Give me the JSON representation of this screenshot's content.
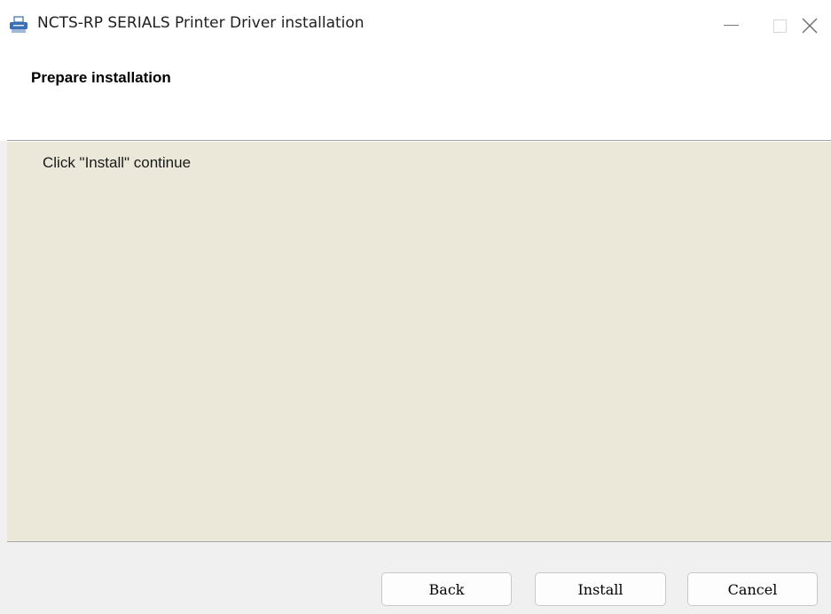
{
  "window": {
    "title": "NCTS-RP SERIALS Printer Driver installation",
    "icon": "printer-icon"
  },
  "title_controls": {
    "minimize": "minimize-icon",
    "maximize": "maximize-icon",
    "close": "close-icon"
  },
  "header": {
    "title": "Prepare installation"
  },
  "content": {
    "message": "Click \"Install\" continue"
  },
  "buttons": {
    "back": "Back",
    "install": "Install",
    "cancel": "Cancel"
  },
  "colors": {
    "content_background": "#ebe8d9",
    "window_background": "#f0f0f0"
  }
}
